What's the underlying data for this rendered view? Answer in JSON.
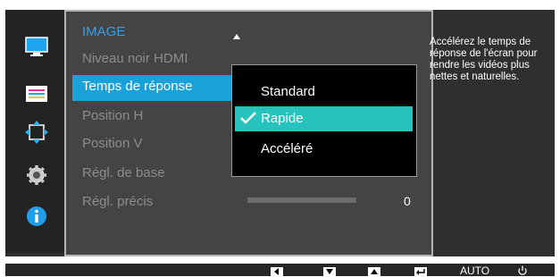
{
  "menu": {
    "title": "IMAGE",
    "items": [
      {
        "label": "Niveau noir HDMI",
        "state": "disabled"
      },
      {
        "label": "Temps de réponse",
        "state": "selected"
      },
      {
        "label": "Position H",
        "state": "disabled"
      },
      {
        "label": "Position V",
        "state": "disabled"
      },
      {
        "label": "Régl. de base",
        "state": "disabled"
      },
      {
        "label": "Régl. précis",
        "state": "disabled"
      }
    ]
  },
  "popup": {
    "options": [
      "Standard",
      "Rapide",
      "Accéléré"
    ],
    "selected": "Rapide"
  },
  "slider": {
    "value": "0"
  },
  "help": {
    "text": "Accélérez le temps de réponse de l'écran pour rendre les vidéos plus nettes et naturelles."
  },
  "sidebar": {
    "icons": [
      "monitor-icon",
      "picture-settings-icon",
      "resize-icon",
      "gear-icon",
      "info-icon"
    ]
  },
  "bottom": {
    "auto_label": "AUTO",
    "keys": [
      "left-arrow-icon",
      "down-arrow-icon",
      "up-arrow-icon",
      "enter-icon",
      "power-icon"
    ]
  },
  "colors": {
    "accent_blue": "#19a2d9",
    "selection_teal": "#27c3bd",
    "title_blue": "#3aa0e4"
  }
}
